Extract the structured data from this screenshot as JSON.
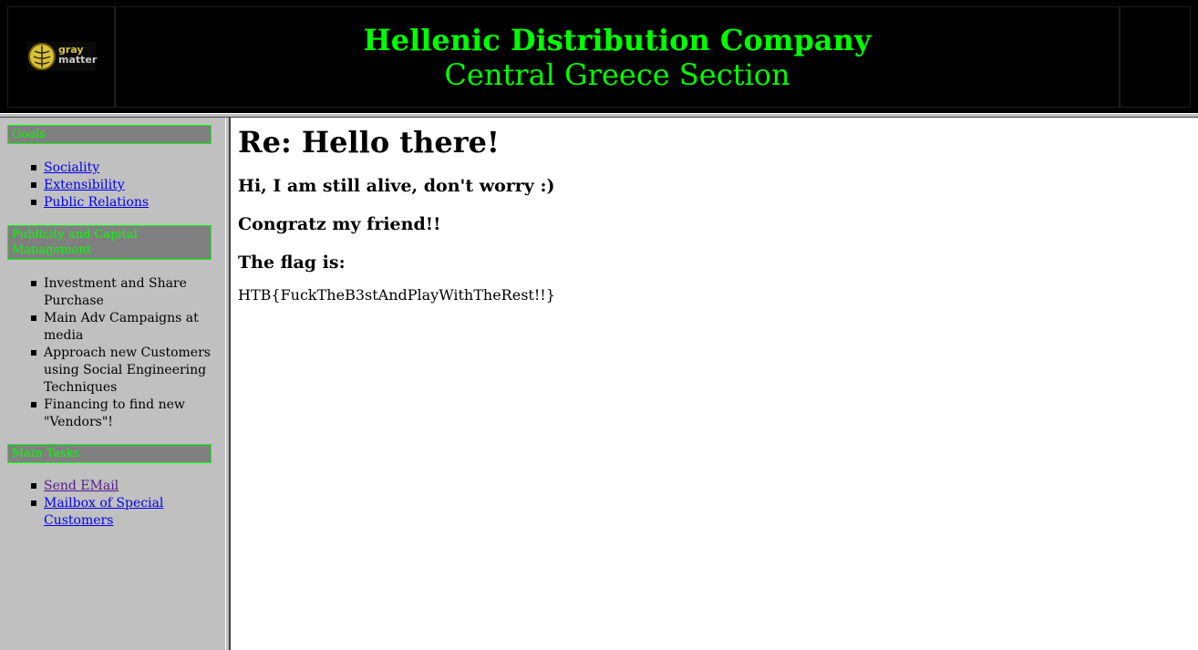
{
  "header": {
    "logo": {
      "line1": "gray",
      "line2": "matter"
    },
    "company_title": "Hellenic Distribution Company",
    "section_title": "Central Greece Section"
  },
  "sidebar": {
    "sections": [
      {
        "heading": "Goals",
        "items": [
          {
            "label": "Sociality",
            "link": true
          },
          {
            "label": "Extensibility",
            "link": true
          },
          {
            "label": "Public Relations",
            "link": true
          }
        ]
      },
      {
        "heading": "Publicity and Capital Management",
        "items": [
          {
            "label": "Investment and Share Purchase",
            "link": false
          },
          {
            "label": "Main Adv Campaigns at media",
            "link": false
          },
          {
            "label": "Approach new Customers using Social Engineering Techniques",
            "link": false
          },
          {
            "label": "Financing to find new \"Vendors\"!",
            "link": false
          }
        ]
      },
      {
        "heading": "Main Tasks",
        "items": [
          {
            "label": "Send EMail",
            "link": true,
            "visited": true
          },
          {
            "label": "Mailbox of Special Customers",
            "link": true
          }
        ]
      }
    ]
  },
  "main": {
    "title": "Re: Hello there!",
    "line1": "Hi, I am still alive, don't worry :)",
    "line2": "Congratz my friend!!",
    "line3": "The flag is:",
    "flag": "HTB{FuckTheB3stAndPlayWithTheRest!!}"
  },
  "colors": {
    "header_bg": "#000000",
    "title_green": "#00ff00",
    "sidebar_bg": "#c0c0c0",
    "sidebar_heading_bg": "#808080",
    "link": "#0000ee",
    "visited_link": "#551a8b"
  }
}
